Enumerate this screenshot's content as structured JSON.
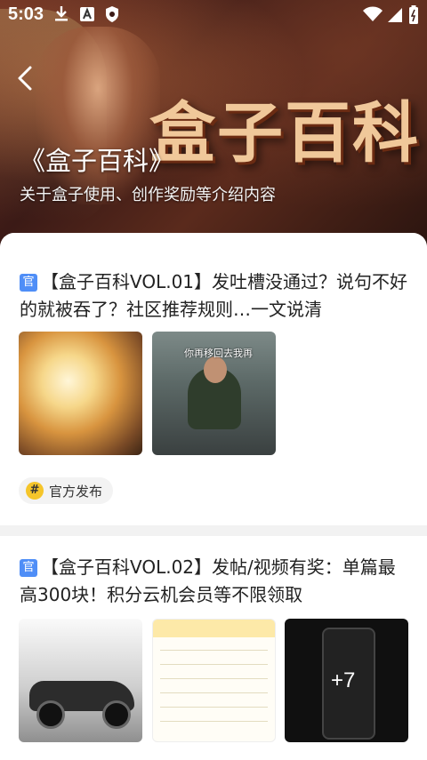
{
  "status_bar": {
    "time": "5:03",
    "left_icons": [
      "download-icon",
      "a-letter-icon",
      "shield-icon"
    ],
    "right_icons": [
      "wifi-icon",
      "signal-icon",
      "battery-icon"
    ]
  },
  "header": {
    "banner_logo_text": "盒子百科",
    "title": "《盒子百科》",
    "subtitle": "关于盒子使用、创作奖励等介绍内容"
  },
  "posts": [
    {
      "badge": "官",
      "title": "【盒子百科VOL.01】发吐槽没通过？说句不好的就被吞了？社区推荐规则…一文说清",
      "images": [
        "glowing-sword-image",
        "office-meme-image"
      ],
      "meme_caption": "你再移回去我再",
      "tag": {
        "icon": "#",
        "label": "官方发布"
      }
    },
    {
      "badge": "官",
      "title": "【盒子百科VOL.02】发帖/视频有奖：单篇最高300块！积分云机会员等不限领取",
      "images": [
        "sports-car-image",
        "reward-table-image",
        "phone-screen-image"
      ],
      "phone_text": "+7"
    }
  ],
  "colors": {
    "badge_blue": "#4f8ef7",
    "tag_yellow": "#f5c52a"
  }
}
